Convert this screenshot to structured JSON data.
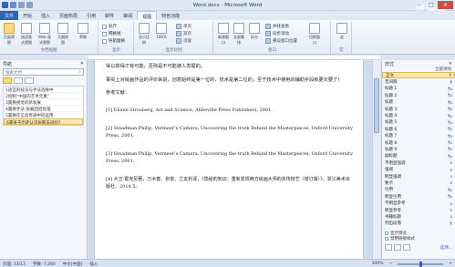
{
  "window": {
    "title": "Word.docx - Microsoft Word",
    "watermark": "虎课网"
  },
  "tabs": [
    {
      "label": "文件",
      "state": "file"
    },
    {
      "label": "开始",
      "state": ""
    },
    {
      "label": "插入",
      "state": ""
    },
    {
      "label": "页面布局",
      "state": ""
    },
    {
      "label": "引用",
      "state": ""
    },
    {
      "label": "邮件",
      "state": ""
    },
    {
      "label": "审阅",
      "state": ""
    },
    {
      "label": "视图",
      "state": "active"
    },
    {
      "label": "特色功能",
      "state": ""
    }
  ],
  "ribbon": {
    "views": {
      "label": "文档视图",
      "buttons": [
        "页面视图",
        "阅读版式视图",
        "Web 版式视图",
        "大纲视图",
        "草稿"
      ]
    },
    "show": {
      "label": "显示",
      "checks": [
        "标尺",
        "网格线",
        "导航窗格"
      ]
    },
    "zoom": {
      "label": "显示比例",
      "buttons": [
        "显示比例",
        "100%"
      ],
      "small": [
        "单页",
        "双页",
        "页宽"
      ]
    },
    "window": {
      "label": "窗口",
      "buttons": [
        "新建窗口",
        "全部重排",
        "拆分"
      ],
      "small": [
        "并排查看",
        "同步滚动",
        "重设窗口位置"
      ],
      "switch": "切换窗口"
    },
    "macro": {
      "label": "宏",
      "button": "宏"
    }
  },
  "nav": {
    "title": "导航",
    "search_placeholder": "搜索文档",
    "headings": [
      "1适宜的技法与手法选择中",
      "2绘制“中国的艺术元素”",
      "3置换视觉的新发展",
      "4置换手法-张载回后处理",
      "5置换在信息传递中的运用",
      "6置身于历史认识层面去问吗？"
    ],
    "selected_index": 5
  },
  "document": {
    "lines": [
      "得以获得才有可能，否则是不可能被人发掘的。",
      "    事实上对绘画作品的评价来说，创意始终是第一位的，技术是第二位的，至于技术中使用的辅助手段就更次要了！",
      "参考文献：",
      "[1] Eliane Strosberg, Art and Science, Abbeville Press Publishers, 2001.",
      "[2] Steadman Philip, Vermeer’s Camera, Uncovering the truth Behind the Masterpieces, Oxford University Press, 2001.",
      "[3] Steadman Philip, Vermeer’s Camera, Uncovering the truth Behind the Masterpieces, Oxford University Press, 2001.",
      "[4] 大卫·霍克尼著，万木春、张俊、兰友利译，《隐秘的知识：重新发现西方绘画大师的失传技艺（增订版）》，浙江美术出版社，2014.5。"
    ]
  },
  "styles": {
    "title": "样式",
    "select_all": "全部清除",
    "items": [
      {
        "name": "正文",
        "mark": "¶"
      },
      {
        "name": "无间隔",
        "mark": "¶"
      },
      {
        "name": "标题 1",
        "mark": "¶a"
      },
      {
        "name": "标题 2",
        "mark": "¶a"
      },
      {
        "name": "标题",
        "mark": "¶a"
      },
      {
        "name": "标题 3",
        "mark": "¶a"
      },
      {
        "name": "标题 4",
        "mark": "¶a"
      },
      {
        "name": "标题 5",
        "mark": "¶a"
      },
      {
        "name": "标题 6",
        "mark": "¶a"
      },
      {
        "name": "标题 7",
        "mark": "¶a"
      },
      {
        "name": "标题 8",
        "mark": "¶a"
      },
      {
        "name": "标题 9",
        "mark": "¶a"
      },
      {
        "name": "副标题",
        "mark": "¶a"
      },
      {
        "name": "不明显强调",
        "mark": "a"
      },
      {
        "name": "强调",
        "mark": "a"
      },
      {
        "name": "明显强调",
        "mark": "a"
      },
      {
        "name": "要点",
        "mark": "a"
      },
      {
        "name": "引用",
        "mark": "¶a"
      },
      {
        "name": "明显引用",
        "mark": "¶a"
      },
      {
        "name": "不明显参考",
        "mark": "a"
      },
      {
        "name": "明显参考",
        "mark": "a"
      },
      {
        "name": "书籍标题",
        "mark": "a"
      },
      {
        "name": "列出段落",
        "mark": "¶"
      }
    ],
    "selected_index": 0,
    "options": [
      "显示预览",
      "禁用链接样式"
    ],
    "options_link": "选项..."
  },
  "status": {
    "page": "页面: 13/13",
    "words": "字数: 7,260",
    "lang": "中文(中国)",
    "mode": "插入",
    "zoom": "100%",
    "zoom_level": 0.5
  }
}
